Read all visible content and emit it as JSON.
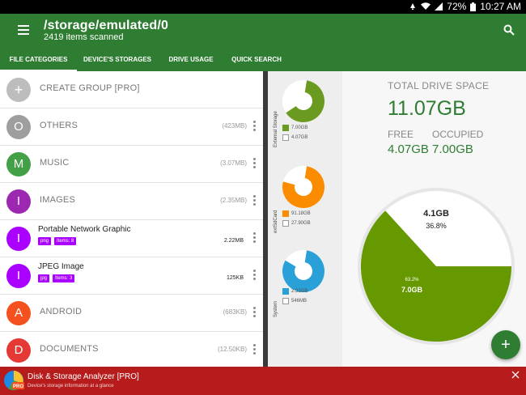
{
  "status": {
    "battery": "72%",
    "time": "10:27 AM"
  },
  "appbar": {
    "path": "/storage/emulated/0",
    "scanned": "2419 items scanned",
    "tabs": [
      {
        "label": "FILE CATEGORIES",
        "active": true
      },
      {
        "label": "DEVICE'S STORAGES"
      },
      {
        "label": "DRIVE USAGE"
      },
      {
        "label": "QUICK SEARCH"
      }
    ]
  },
  "list": [
    {
      "letter": "+",
      "label": "CREATE GROUP [PRO]",
      "color": "#bdbdbd"
    },
    {
      "letter": "O",
      "label": "OTHERS",
      "size": "(423MB)",
      "color": "#9e9e9e"
    },
    {
      "letter": "M",
      "label": "MUSIC",
      "size": "(3.07MB)",
      "color": "#43a047"
    },
    {
      "letter": "I",
      "label": "IMAGES",
      "size": "(2.35MB)",
      "color": "#9c27b0"
    },
    {
      "letter": "I",
      "title": "Portable Network Graphic",
      "tags": [
        "png",
        "Items: 8"
      ],
      "size": "2.22MB",
      "color": "#aa00ff"
    },
    {
      "letter": "I",
      "title": "JPEG Image",
      "tags": [
        "jpg",
        "Items: 3"
      ],
      "size": "125KB",
      "color": "#aa00ff"
    },
    {
      "letter": "A",
      "label": "ANDROID",
      "size": "(683KB)",
      "color": "#f4511e"
    },
    {
      "letter": "D",
      "label": "DOCUMENTS",
      "size": "(12.50KB)",
      "color": "#e53935"
    }
  ],
  "storages": [
    {
      "name": "External Storage",
      "used": "7.00GB",
      "free": "4.07GB",
      "used_fraction": 0.632,
      "color": "#6a9a1f"
    },
    {
      "name": "extSdCard",
      "used": "91.18GB",
      "free": "27.90GB",
      "used_fraction": 0.766,
      "color": "#fb8c00"
    },
    {
      "name": "System",
      "used": "2.32GB",
      "free": "546MB",
      "used_fraction": 0.81,
      "color": "#29a0d8"
    }
  ],
  "drive": {
    "total_label": "TOTAL DRIVE SPACE",
    "total_value": "11.07GB",
    "free_label": "FREE",
    "occupied_label": "OCCUPIED",
    "free_value": "4.07GB",
    "occupied_value": "7.00GB",
    "pie": {
      "used_pct": 63.2,
      "used_pct_label": "63.2%",
      "used_label": "7.0GB",
      "free_pct_label": "36.8%",
      "free_label": "4.1GB",
      "used_color": "#669900",
      "free_color": "#ffffff"
    }
  },
  "fab": "+",
  "ad": {
    "title": "Disk & Storage Analyzer [PRO]",
    "subtitle": "Device's storage information at a glance",
    "badge": "PRO"
  }
}
